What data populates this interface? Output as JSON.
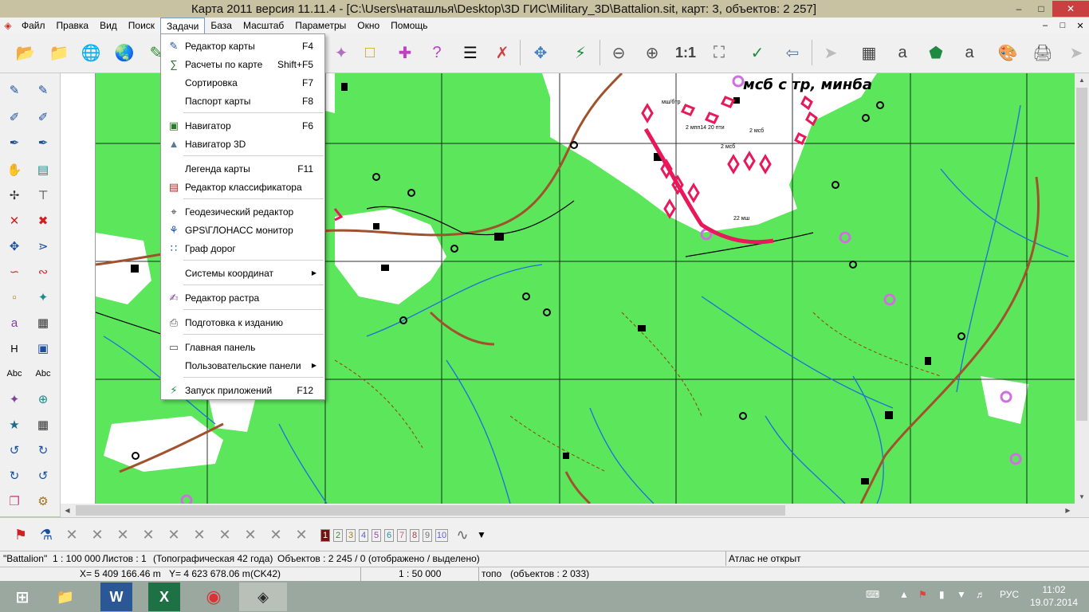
{
  "window": {
    "title": "Карта 2011 версия 11.11.4 - [C:\\Users\\наташлья\\Desktop\\3D ГИС\\Military_3D\\Battalion.sit, карт: 3, объектов: 2 257]",
    "min": "–",
    "max": "□",
    "close": "✕"
  },
  "menu": {
    "items": [
      "Файл",
      "Правка",
      "Вид",
      "Поиск",
      "Задачи",
      "База",
      "Масштаб",
      "Параметры",
      "Окно",
      "Помощь"
    ],
    "active_index": 4,
    "mdi": [
      "–",
      "□",
      "✕"
    ]
  },
  "dropdown": {
    "items": [
      {
        "icon": "pencil-icon",
        "glyph": "✎",
        "label": "Редактор карты",
        "shortcut": "F4"
      },
      {
        "icon": "calculator-icon",
        "glyph": "∑",
        "label": "Расчеты по карте",
        "shortcut": "Shift+F5"
      },
      {
        "icon": "",
        "glyph": "",
        "label": "Сортировка",
        "shortcut": "F7"
      },
      {
        "icon": "",
        "glyph": "",
        "label": "Паспорт карты",
        "shortcut": "F8"
      },
      {
        "icon": "navigator-icon",
        "glyph": "▣",
        "label": "Навигатор",
        "shortcut": "F6"
      },
      {
        "icon": "navigator-3d-icon",
        "glyph": "▲",
        "label": "Навигатор 3D",
        "shortcut": ""
      },
      {
        "icon": "",
        "glyph": "",
        "label": "Легенда карты",
        "shortcut": "F11"
      },
      {
        "icon": "classifier-icon",
        "glyph": "▤",
        "label": "Редактор классификатора",
        "shortcut": ""
      },
      {
        "icon": "geodesic-icon",
        "glyph": "⌖",
        "label": "Геодезический редактор",
        "shortcut": ""
      },
      {
        "icon": "gps-icon",
        "glyph": "⚘",
        "label": "GPS\\ГЛОНАСС монитор",
        "shortcut": ""
      },
      {
        "icon": "road-graph-icon",
        "glyph": "∷",
        "label": "Граф дорог",
        "shortcut": ""
      },
      {
        "icon": "",
        "glyph": "",
        "label": "Системы координат",
        "shortcut": "",
        "submenu": true
      },
      {
        "icon": "raster-icon",
        "glyph": "✍",
        "label": "Редактор растра",
        "shortcut": ""
      },
      {
        "icon": "print-prep-icon",
        "glyph": "⎙",
        "label": "Подготовка к изданию",
        "shortcut": ""
      },
      {
        "icon": "main-panel-icon",
        "glyph": "▭",
        "label": "Главная панель",
        "shortcut": ""
      },
      {
        "icon": "",
        "glyph": "",
        "label": "Пользовательские панели",
        "shortcut": "",
        "submenu": true
      },
      {
        "icon": "launch-icon",
        "glyph": "⚡",
        "label": "Запуск приложений",
        "shortcut": "F12"
      }
    ]
  },
  "toolbar": {
    "zoom_label": "1:1"
  },
  "left_tools": {
    "labels": [
      "H",
      "Abc",
      "Abc"
    ]
  },
  "map": {
    "labels": [
      "мсб с тр, минба"
    ],
    "background": "#5ce65c",
    "white_area": "#ffffff",
    "road_color": "#a0522d",
    "water_color": "#1e6fd9",
    "symbol_color": "#e8185a",
    "grid_color": "#000000"
  },
  "bottom_toolbar": {
    "layers": [
      "1",
      "2",
      "3",
      "4",
      "5",
      "6",
      "7",
      "8",
      "9",
      "10"
    ]
  },
  "status": {
    "map_name": "\"Battalion\"",
    "scale": "1 : 100 000",
    "sheets": "Листов : 1",
    "type": "(Топографическая 42 года)",
    "objects": "Объектов : 2 245 / 0 (отображено / выделено)",
    "atlas": "Атлас не открыт",
    "x": "X= 5 409 166.46 m",
    "y": "Y= 4 623 678.06 m",
    "cs": "(CK42)",
    "current_scale": "1 : 50 000",
    "topo": "топо",
    "topo_objects": "(объектов : 2 033)"
  },
  "taskbar": {
    "lang": "РУС",
    "time": "11:02",
    "date": "19.07.2014"
  }
}
